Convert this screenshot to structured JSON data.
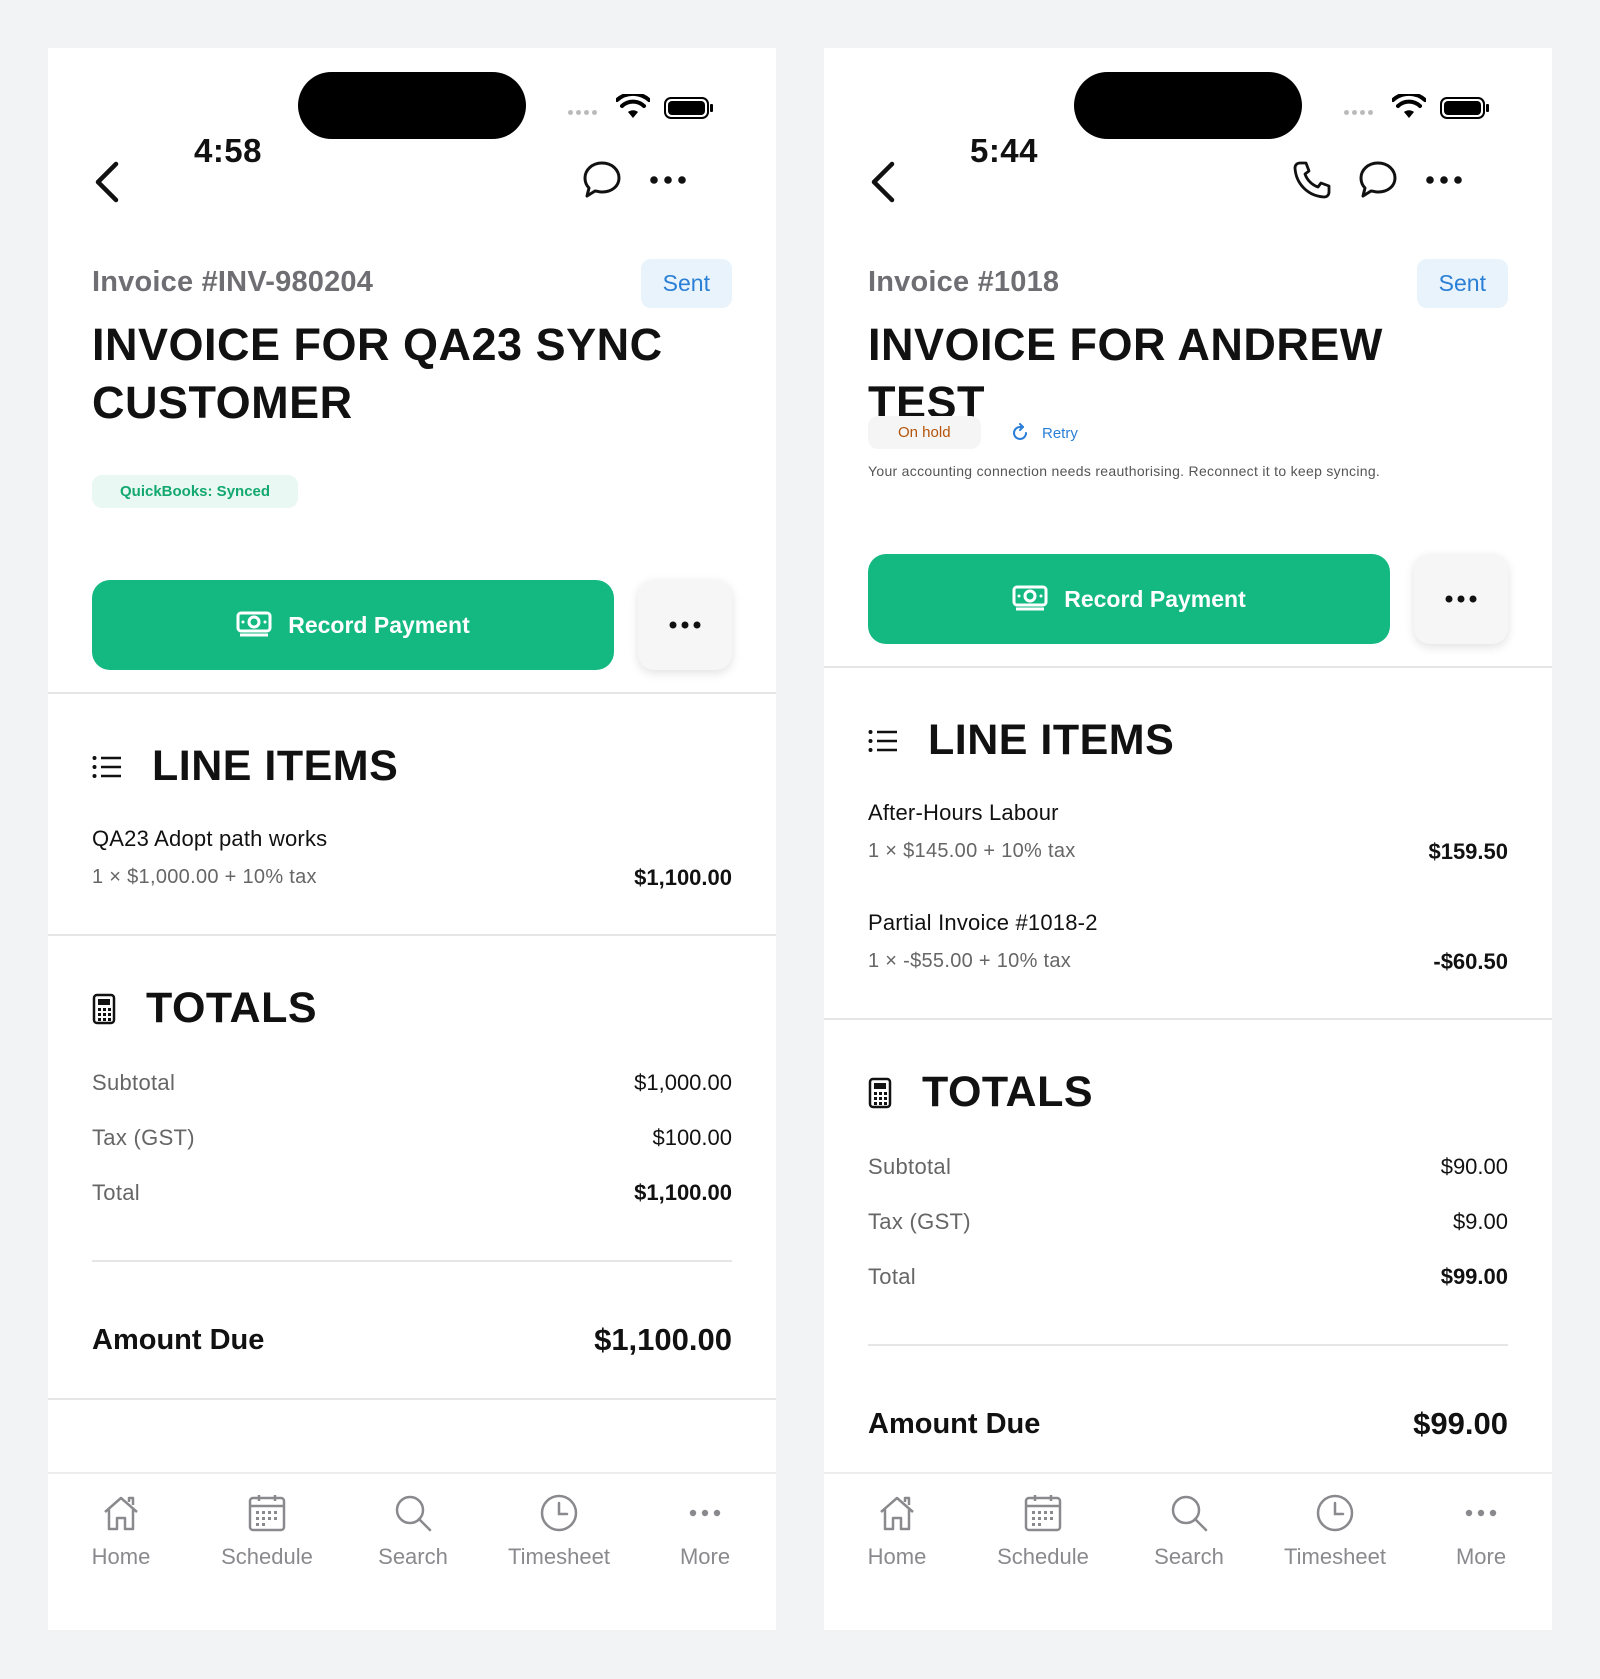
{
  "left": {
    "status_time": "4:58",
    "invoice_number": "Invoice #INV-980204",
    "status_badge": "Sent",
    "title": "INVOICE FOR QA23 SYNC CUSTOMER",
    "sync_badge": "QuickBooks: Synced",
    "record_payment_label": "Record Payment",
    "line_items_heading": "LINE ITEMS",
    "line_items": [
      {
        "name": "QA23 Adopt path works",
        "detail": "1 × $1,000.00 + 10% tax",
        "amount": "$1,100.00"
      }
    ],
    "totals_heading": "TOTALS",
    "subtotal_label": "Subtotal",
    "subtotal": "$1,000.00",
    "tax_label": "Tax (GST)",
    "tax": "$100.00",
    "total_label": "Total",
    "total": "$1,100.00",
    "amount_due_label": "Amount Due",
    "amount_due": "$1,100.00"
  },
  "right": {
    "status_time": "5:44",
    "invoice_number": "Invoice #1018",
    "status_badge": "Sent",
    "title": "INVOICE FOR ANDREW TEST",
    "sync_badge": "On hold",
    "retry_label": "Retry",
    "warning_text": "Your accounting connection needs reauthorising. Reconnect it to keep syncing.",
    "record_payment_label": "Record Payment",
    "line_items_heading": "LINE ITEMS",
    "line_items": [
      {
        "name": "After-Hours Labour",
        "detail": "1 × $145.00 + 10% tax",
        "amount": "$159.50"
      },
      {
        "name": "Partial Invoice #1018-2",
        "detail": "1 × -$55.00 + 10% tax",
        "amount": "-$60.50"
      }
    ],
    "totals_heading": "TOTALS",
    "subtotal_label": "Subtotal",
    "subtotal": "$90.00",
    "tax_label": "Tax (GST)",
    "tax": "$9.00",
    "total_label": "Total",
    "total": "$99.00",
    "amount_due_label": "Amount Due",
    "amount_due": "$99.00"
  },
  "tabs": [
    "Home",
    "Schedule",
    "Search",
    "Timesheet",
    "More"
  ],
  "icons": {
    "back": "chevron-left-icon",
    "chat": "chat-bubble-icon",
    "more": "ellipsis-icon",
    "phone": "phone-icon",
    "money": "money-icon",
    "list": "list-icon",
    "calculator": "calculator-icon",
    "retry": "refresh-icon",
    "home": "home-icon",
    "schedule": "calendar-icon",
    "search": "search-icon",
    "timesheet": "clock-icon"
  },
  "colors": {
    "brand_green": "#14b982",
    "link_blue": "#2b7fd6",
    "hold_orange": "#b45309"
  }
}
